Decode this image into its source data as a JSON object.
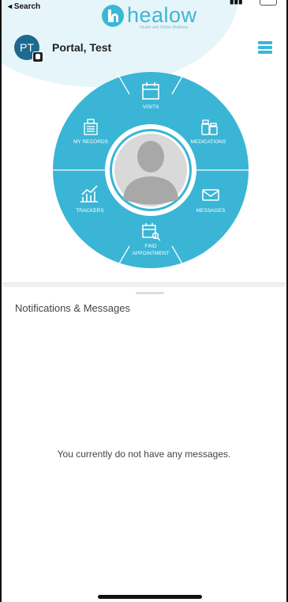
{
  "status_bar": {
    "back_label": "◂ Search"
  },
  "brand": {
    "name": "healow",
    "tagline": "Health and Online Wellness"
  },
  "user": {
    "initials": "PT",
    "name": "Portal, Test"
  },
  "wheel": {
    "items": [
      {
        "key": "visits",
        "label": "VISITS",
        "icon": "calendar-icon"
      },
      {
        "key": "medications",
        "label": "MEDICATIONS",
        "icon": "pill-bottles-icon"
      },
      {
        "key": "messages",
        "label": "MESSAGES",
        "icon": "envelope-icon"
      },
      {
        "key": "find-appointment",
        "label_lines": [
          "FIND",
          "APPOINTMENT"
        ],
        "icon": "calendar-search-icon"
      },
      {
        "key": "trackers",
        "label": "TRACKERS",
        "icon": "chart-trend-icon"
      },
      {
        "key": "my-records",
        "label": "MY RECORDS",
        "icon": "medical-records-icon"
      }
    ]
  },
  "notifications": {
    "title": "Notifications & Messages",
    "empty_text": "You currently do not have any messages."
  },
  "colors": {
    "accent": "#3bb7d6",
    "avatar_bg": "#1d6a8f",
    "text_dark": "#222222"
  }
}
